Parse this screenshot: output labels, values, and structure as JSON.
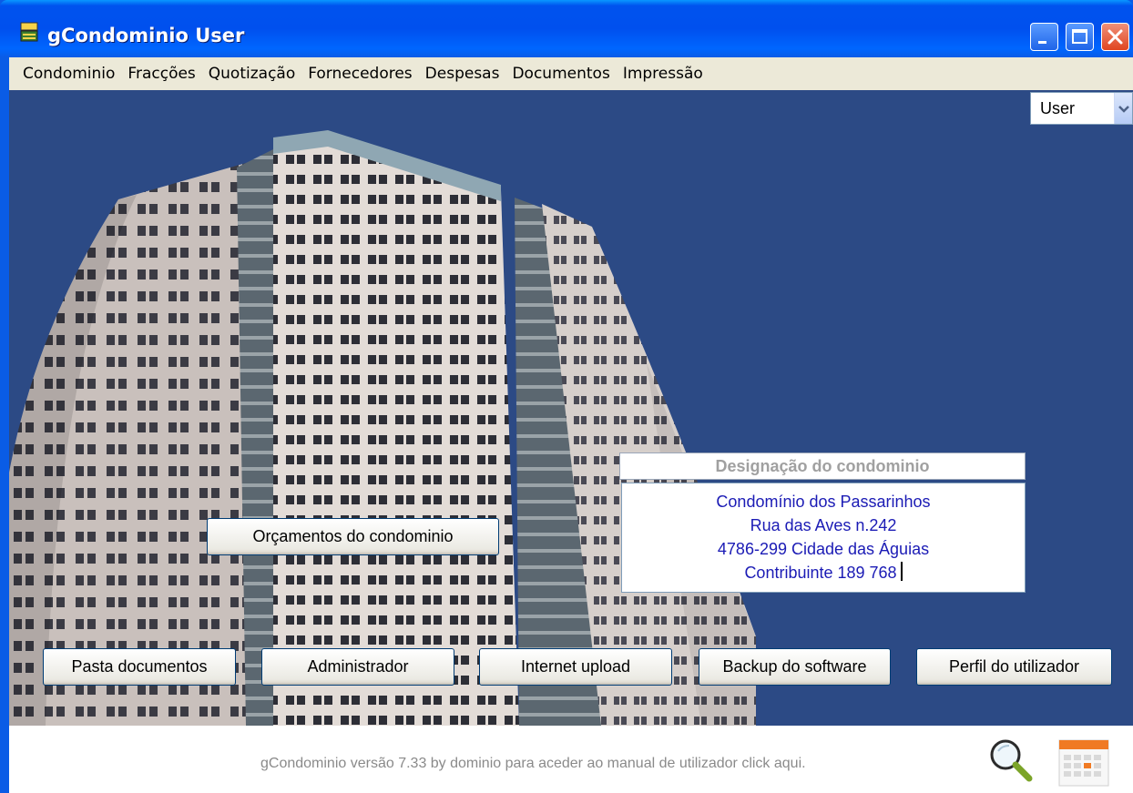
{
  "window": {
    "title": "gCondominio User",
    "title_icon": "app-icon",
    "controls": [
      "minimize-icon",
      "maximize-icon",
      "close-icon"
    ]
  },
  "menu": {
    "items": [
      "Condominio",
      "Fracções",
      "Quotização",
      "Fornecedores",
      "Despesas",
      "Documentos",
      "Impressão"
    ]
  },
  "user_select": {
    "value": "User",
    "icon": "chevron-down-icon"
  },
  "designation": {
    "header": "Designação do condominio",
    "lines": [
      "Condomínio dos Passarinhos",
      "Rua das Aves n.242",
      "4786-299 Cidade das Águias",
      "Contribuinte 189 768"
    ]
  },
  "buttons": {
    "orcamentos": "Orçamentos do condominio",
    "pasta": "Pasta documentos",
    "administrador": "Administrador",
    "upload": "Internet upload",
    "backup": "Backup do software",
    "perfil": "Perfil do utilizador"
  },
  "footer": {
    "text": "gCondominio versão 7.33 by dominio para aceder ao manual de utilizador click aqui.",
    "icons": [
      "magnifier-icon",
      "calendar-icon"
    ]
  },
  "colors": {
    "titlebar": "#0054e3",
    "menubar": "#ece9d8",
    "background": "#2c4a85",
    "designation_text": "#1b1bb5",
    "footer_text": "#8a8a8a"
  }
}
